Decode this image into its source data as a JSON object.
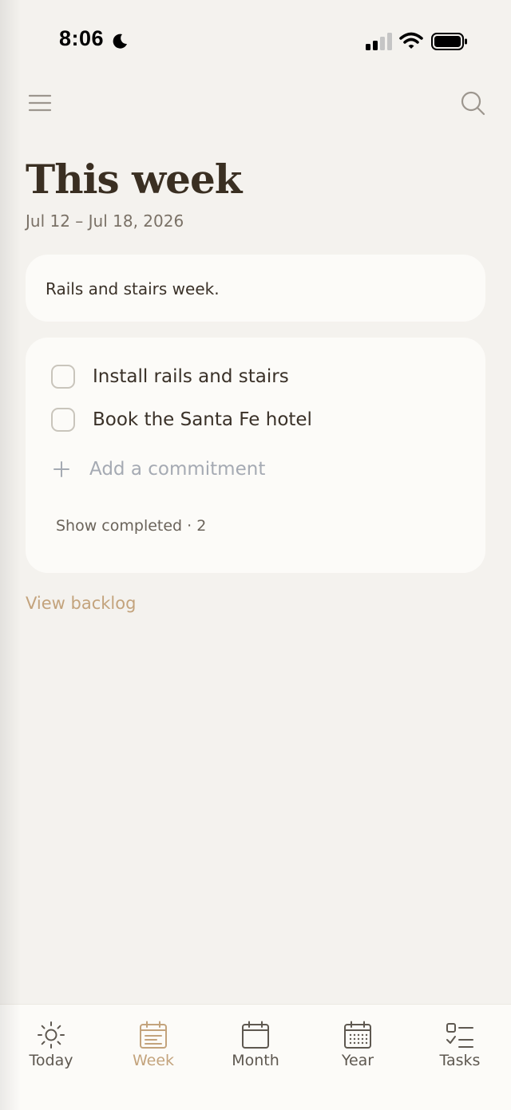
{
  "status": {
    "time": "8:06"
  },
  "header": {
    "menu_icon": "hamburger-menu-icon",
    "search_icon": "search-icon"
  },
  "page": {
    "title": "This week",
    "date_range": "Jul 12 – Jul 18, 2026"
  },
  "note": {
    "text": "Rails and stairs week."
  },
  "commitments": {
    "items": [
      {
        "label": "Install rails and stairs",
        "checked": false
      },
      {
        "label": "Book the Santa Fe hotel",
        "checked": false
      }
    ],
    "add_placeholder": "Add a commitment",
    "show_completed": "Show completed · 2"
  },
  "backlog_link": "View backlog",
  "tabs": [
    {
      "label": "Today",
      "icon": "sun-icon",
      "active": false
    },
    {
      "label": "Week",
      "icon": "calendar-week-icon",
      "active": true
    },
    {
      "label": "Month",
      "icon": "calendar-month-icon",
      "active": false
    },
    {
      "label": "Year",
      "icon": "calendar-year-icon",
      "active": false
    },
    {
      "label": "Tasks",
      "icon": "task-list-icon",
      "active": false
    }
  ],
  "colors": {
    "background": "#F4F2EE",
    "card": "#FCFBF8",
    "accent": "#C3A37C",
    "text": "#3A3128",
    "muted": "#7A7166",
    "placeholder": "#A5AAB3"
  }
}
